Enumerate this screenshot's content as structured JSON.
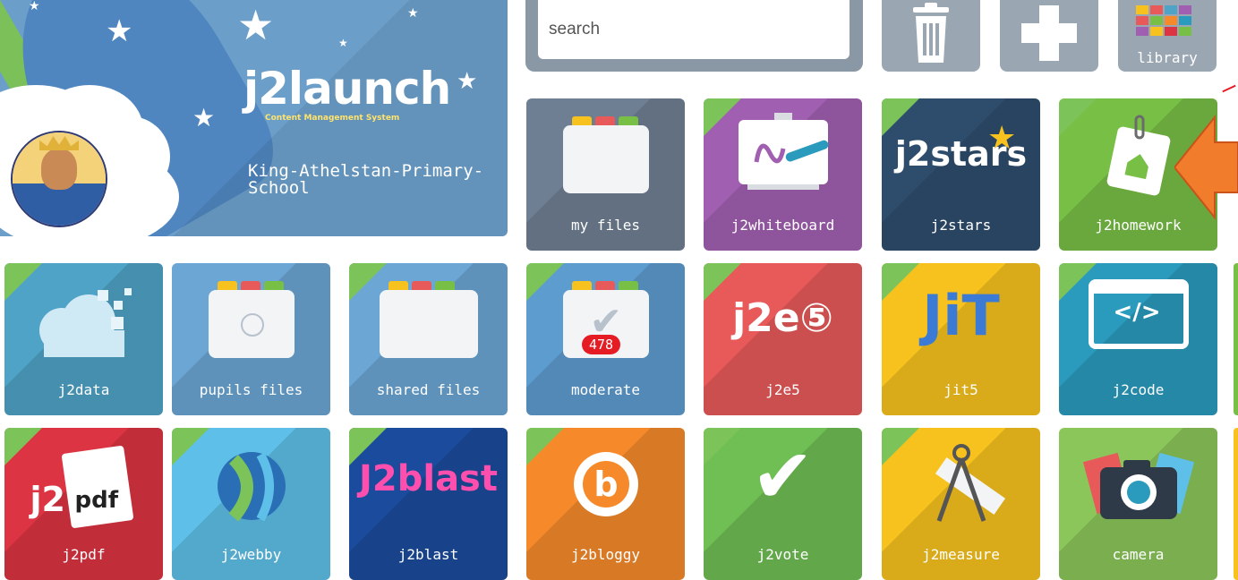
{
  "banner": {
    "logo": "j2launch",
    "subtitle": "Content Management System",
    "school": "King-Athelstan-Primary-School"
  },
  "toolbar": {
    "search_placeholder": "search",
    "library_label": "library"
  },
  "tiles": [
    {
      "label": "my files",
      "color": "#6f7f93"
    },
    {
      "label": "j2whiteboard",
      "color": "#a15fb1"
    },
    {
      "label": "j2stars",
      "color": "#2e4d6d",
      "icon_text": "j2stars"
    },
    {
      "label": "j2homework",
      "color": "#78bf46"
    },
    {
      "label": "j2data",
      "color": "#4fa3c6"
    },
    {
      "label": "pupils files",
      "color": "#6ba6d4"
    },
    {
      "label": "shared files",
      "color": "#6ba6d4"
    },
    {
      "label": "moderate",
      "color": "#5d9ccf",
      "badge": "478"
    },
    {
      "label": "j2e5",
      "color": "#e85a5a",
      "icon_text": "j2e⑤"
    },
    {
      "label": "jit5",
      "color": "#f7c21d",
      "icon_text": "JiT"
    },
    {
      "label": "j2code",
      "color": "#2a9bbd",
      "icon_text": "</>"
    },
    {
      "label": "j2pdf",
      "color": "#dc3442",
      "icon_text": "pdf"
    },
    {
      "label": "j2webby",
      "color": "#5ec0e8"
    },
    {
      "label": "j2blast",
      "color": "#1b4b9c",
      "icon_text": "J2blast"
    },
    {
      "label": "j2bloggy",
      "color": "#f68a2a"
    },
    {
      "label": "j2vote",
      "color": "#6fbf54"
    },
    {
      "label": "j2measure",
      "color": "#f7c21d"
    },
    {
      "label": "camera",
      "color": "#8bc65a"
    }
  ],
  "colors": {
    "banner": "#6b9fca",
    "corner": "#7cc35a",
    "badge": "#e51c23",
    "arrow": "#f07c2c"
  }
}
